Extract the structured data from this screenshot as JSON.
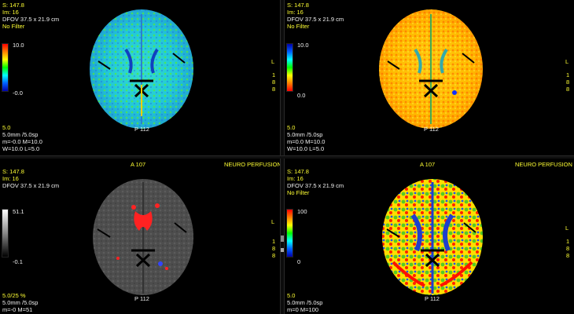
{
  "viewports": {
    "tl": {
      "header": [
        "S: 147.8",
        "Im: 16",
        "DFOV 37.5 x 21.9 cm",
        "No Filter"
      ],
      "colorbar": {
        "max": "10.0",
        "min": "-0.0"
      },
      "side_letters": [
        "L",
        "1",
        "8",
        "8"
      ],
      "bottom_label": "P 112",
      "footer": [
        "5.0",
        "5.0mm /5.0sp",
        "m=-0.0 M=10.0",
        "W=10.0 L=5.0"
      ]
    },
    "tr": {
      "header": [
        "S: 147.8",
        "Im: 16",
        "DFOV 37.5 x 21.9 cm",
        "No Filter"
      ],
      "colorbar": {
        "max": "10.0",
        "min": "0.0"
      },
      "side_letters": [
        "L",
        "1",
        "8",
        "8"
      ],
      "bottom_label": "P 112",
      "footer": [
        "5.0",
        "5.0mm /5.0sp",
        "m=0.0 M=10.0",
        "W=10.0 L=5.0"
      ]
    },
    "bl": {
      "top_center": "A 107",
      "top_right": "NEURO PERFUSION",
      "header": [
        "S: 147.8",
        "Im: 16",
        "DFOV 37.5 x 21.9 cm"
      ],
      "colorbar": {
        "max": "51.1",
        "min": "-0.1"
      },
      "side_letters": [
        "L",
        "1",
        "8",
        "8"
      ],
      "bottom_label": "P 112",
      "footer": [
        "5.0/25 %",
        "5.0mm /5.0sp",
        "m=-0 M=51"
      ]
    },
    "br": {
      "top_center": "A 107",
      "top_right": "NEURO PERFUSION",
      "header": [
        "S: 147.8",
        "Im: 16",
        "DFOV 37.5 x 21.9 cm",
        "No Filter"
      ],
      "colorbar": {
        "max": "100",
        "min": "0"
      },
      "side_letters": [
        "L",
        "1",
        "8",
        "8"
      ],
      "bottom_label": "P 112",
      "footer": [
        "5.0",
        "5.0mm /5.0sp",
        "m=0 M=100"
      ]
    }
  },
  "colors": {
    "overlay_text": "#ffff33",
    "label_text": "#f2f2f2"
  }
}
